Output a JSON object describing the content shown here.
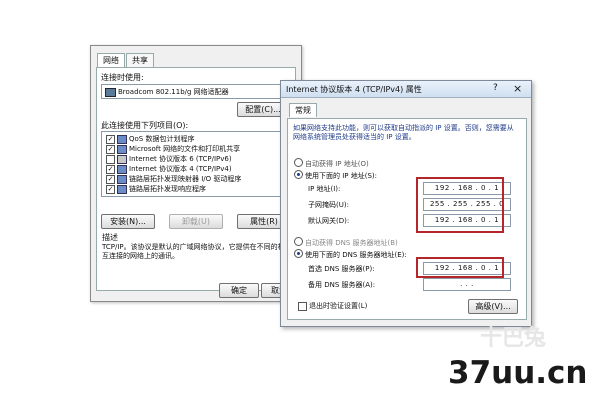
{
  "left": {
    "tabs": [
      "网络",
      "共享"
    ],
    "connect_using_label": "连接时使用:",
    "adapter": "Broadcom 802.11b/g 网络适配器",
    "configure_btn": "配置(C)...",
    "items_label": "此连接使用下列项目(O):",
    "components": [
      {
        "checked": true,
        "label": "QoS 数据包计划程序"
      },
      {
        "checked": true,
        "label": "Microsoft 网络的文件和打印机共享"
      },
      {
        "checked": false,
        "label": "Internet 协议版本 6 (TCP/IPv6)"
      },
      {
        "checked": true,
        "label": "Internet 协议版本 4 (TCP/IPv4)"
      },
      {
        "checked": true,
        "label": "链路层拓扑发现映射器 I/O 驱动程序"
      },
      {
        "checked": true,
        "label": "链路层拓扑发现响应程序"
      }
    ],
    "install_btn": "安装(N)...",
    "uninstall_btn": "卸载(U)",
    "properties_btn": "属性(R)",
    "description_label": "描述",
    "description_text": "TCP/IP。该协议是默认的广域网络协议，它提供在不同的相互连接的网络上的通讯。",
    "ok_btn": "确定",
    "cancel_btn": "取消"
  },
  "right": {
    "title": "Internet 协议版本 4 (TCP/IPv4) 属性",
    "help_glyph": "?",
    "close_glyph": "×",
    "tab": "常规",
    "intro": "如果网络支持此功能，则可以获取自动指派的 IP 设置。否则，您需要从网络系统管理员处获得适当的 IP 设置。",
    "auto_ip": "自动获得 IP 地址(O)",
    "manual_ip": "使用下面的 IP 地址(S):",
    "ip_label": "IP 地址(I):",
    "ip_value": "192 . 168 . 0 . 1",
    "mask_label": "子网掩码(U):",
    "mask_value": "255 . 255 . 255 . 0",
    "gateway_label": "默认网关(D):",
    "gateway_value": "192 . 168 . 0 . 1",
    "auto_dns": "自动获得 DNS 服务器地址(B)",
    "manual_dns": "使用下面的 DNS 服务器地址(E):",
    "pref_dns_label": "首选 DNS 服务器(P):",
    "pref_dns_value": "192 . 168 . 0 . 1",
    "alt_dns_label": "备用 DNS 服务器(A):",
    "alt_dns_value": ". . .",
    "validate_label": "退出时验证设置(L)",
    "advanced_btn": "高级(V)..."
  },
  "watermark": {
    "text": "37uu.cn",
    "faint": "十巴兔"
  },
  "colors": {
    "highlight_box": "#b4262a",
    "titlebar": "#cfdff0"
  }
}
